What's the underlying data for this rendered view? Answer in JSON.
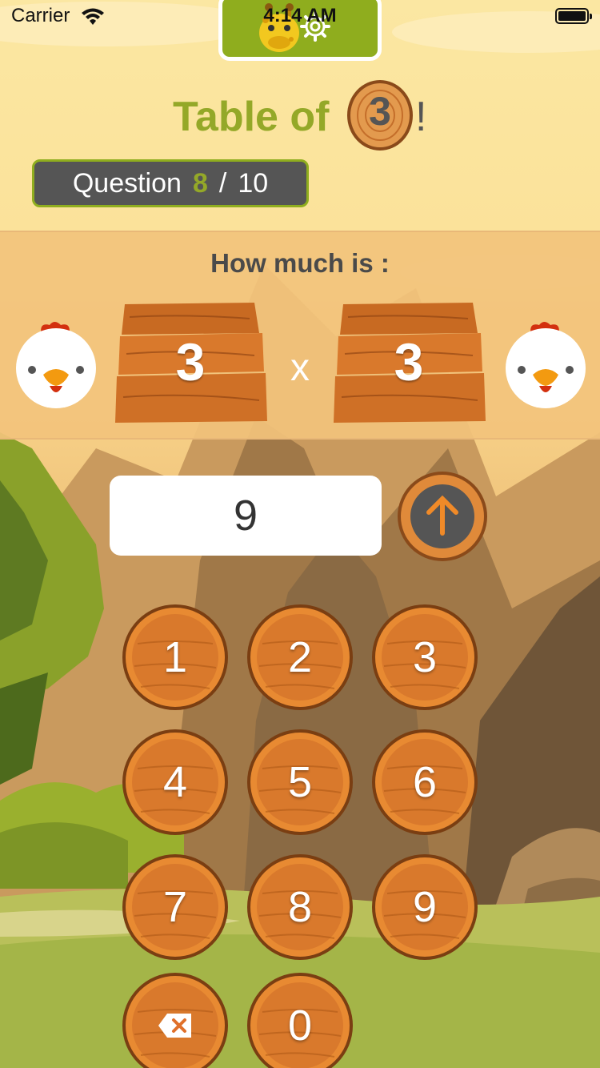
{
  "status_bar": {
    "carrier": "Carrier",
    "time": "4:14 AM"
  },
  "top_tab": {
    "icons": [
      "giraffe-icon",
      "gear-icon"
    ]
  },
  "title": {
    "prefix": "Table of",
    "number": "3",
    "suffix": "!"
  },
  "progress": {
    "label": "Question",
    "current": "8",
    "separator": "/",
    "total": "10"
  },
  "question": {
    "prompt": "How much is :",
    "left_operand": "3",
    "operator": "x",
    "right_operand": "3"
  },
  "answer": {
    "value": "9"
  },
  "keypad": {
    "keys": [
      "1",
      "2",
      "3",
      "4",
      "5",
      "6",
      "7",
      "8",
      "9",
      "0"
    ],
    "delete_icon": "backspace-icon",
    "submit_icon": "arrow-up-icon"
  },
  "colors": {
    "accent_green": "#94a828",
    "panel_gray": "#555555",
    "wood": "#d07a2a",
    "band": "#f2c37c"
  }
}
